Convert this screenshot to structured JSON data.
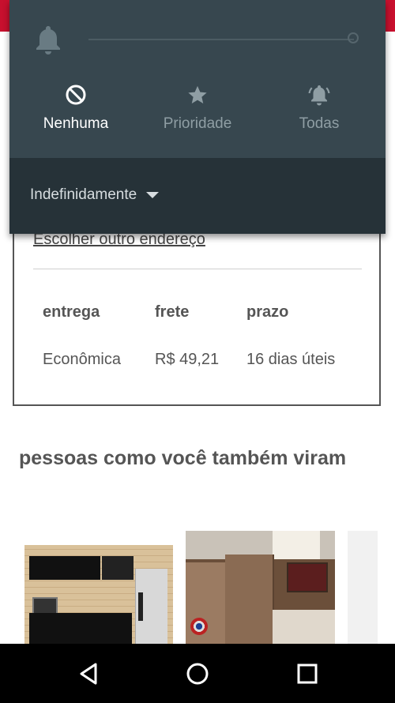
{
  "notification_shade": {
    "modes": [
      {
        "label": "Nenhuma",
        "icon": "block-icon",
        "active": true
      },
      {
        "label": "Prioridade",
        "icon": "star-icon",
        "active": false
      },
      {
        "label": "Todas",
        "icon": "bell-ring-icon",
        "active": false
      }
    ],
    "duration": "Indefinidamente"
  },
  "shipping": {
    "choose_link": "Escolher outro endereço",
    "headers": [
      "entrega",
      "frete",
      "prazo"
    ],
    "row": [
      "Econômica",
      "R$ 49,21",
      "16 dias úteis"
    ]
  },
  "related": {
    "title": "pessoas como você também viram"
  },
  "colors": {
    "brand": "#c8102e",
    "shade": "#37474f",
    "shade_dark": "#263238"
  }
}
